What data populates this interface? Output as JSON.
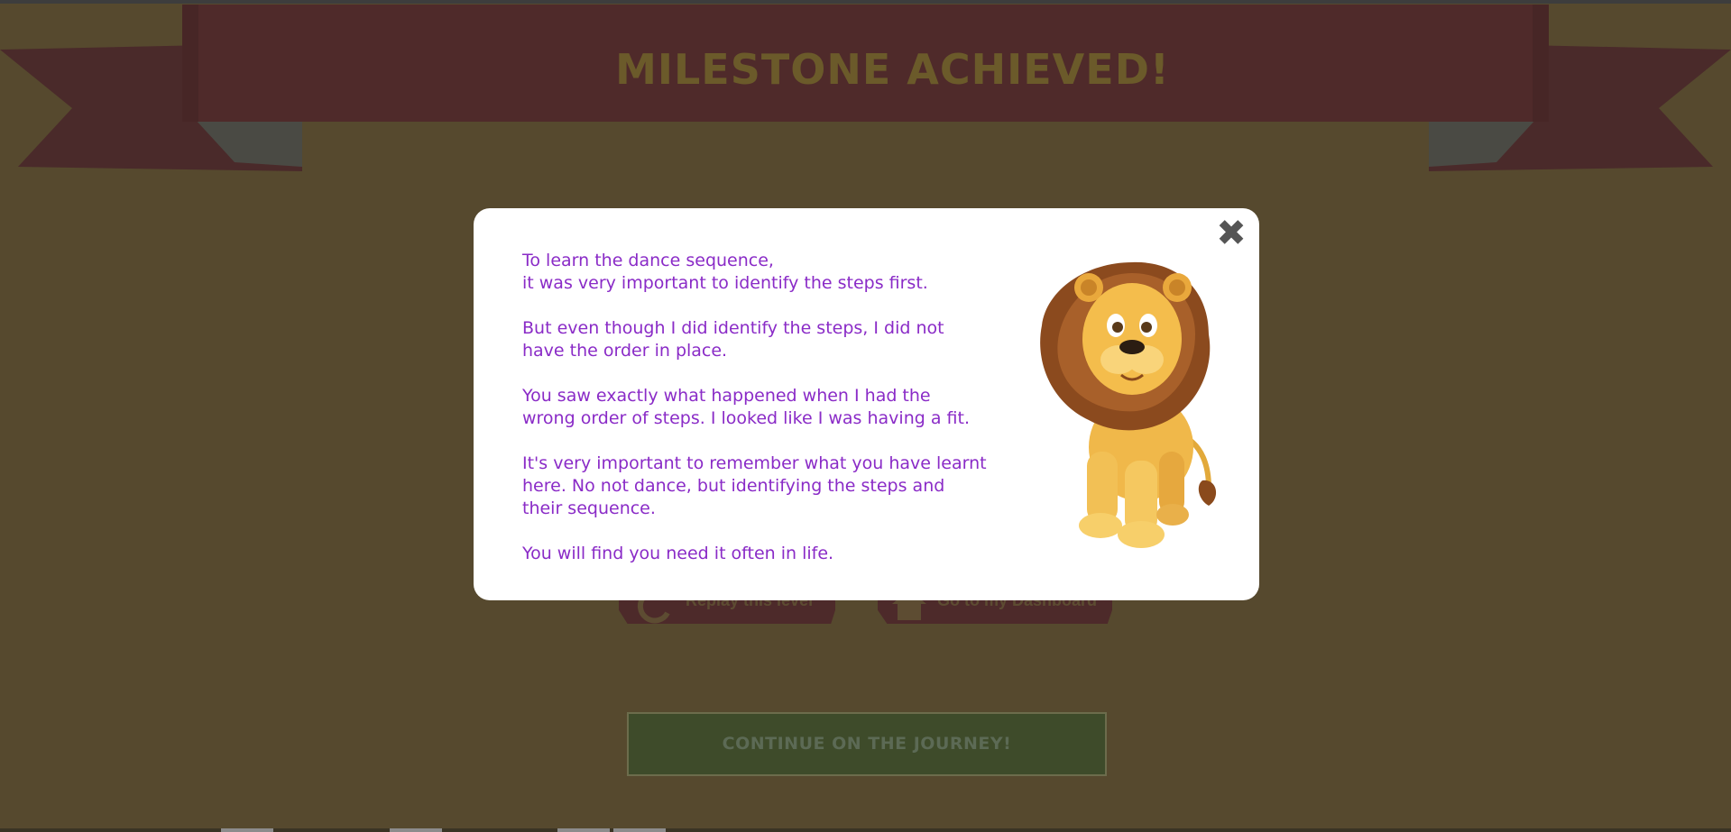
{
  "banner": {
    "title": "MILESTONE ACHIEVED!"
  },
  "buttons": {
    "replay_label": "Replay this level",
    "dashboard_label": "Go to my Dashboard",
    "continue_label": "CONTINUE ON THE JOURNEY!"
  },
  "modal": {
    "close_symbol": "✖",
    "paragraphs": [
      "To learn the dance sequence,\nit was very important to identify the steps first.",
      "But even though I did identify the steps, I did not\nhave the order in place.",
      "You saw exactly what happened when I had the\nwrong order of steps. I looked like I was having a fit.",
      "It's very important to remember what you have learnt\nhere. No not dance, but identifying the steps and\ntheir sequence.",
      "You will find you need it often in life."
    ]
  },
  "icons": {
    "close": "close-icon",
    "replay": "replay-icon",
    "home": "home-icon",
    "lion": "lion-illustration"
  },
  "colors": {
    "overlay_background": "#56492e",
    "banner_ribbon": "#4f2a2a",
    "modal_text": "#8a2bc7",
    "continue_button": "#3e4b2a"
  }
}
